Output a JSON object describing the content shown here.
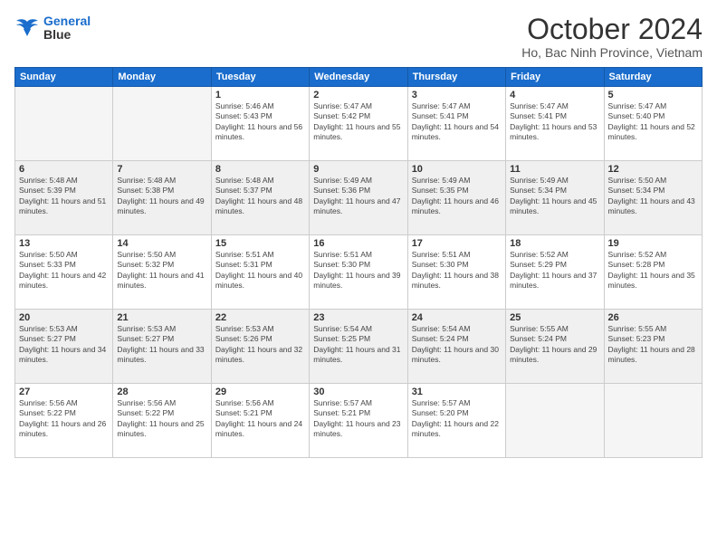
{
  "logo": {
    "line1": "General",
    "line2": "Blue"
  },
  "header": {
    "month": "October 2024",
    "location": "Ho, Bac Ninh Province, Vietnam"
  },
  "weekdays": [
    "Sunday",
    "Monday",
    "Tuesday",
    "Wednesday",
    "Thursday",
    "Friday",
    "Saturday"
  ],
  "weeks": [
    [
      {
        "day": null
      },
      {
        "day": null
      },
      {
        "day": "1",
        "sunrise": "Sunrise: 5:46 AM",
        "sunset": "Sunset: 5:43 PM",
        "daylight": "Daylight: 11 hours and 56 minutes."
      },
      {
        "day": "2",
        "sunrise": "Sunrise: 5:47 AM",
        "sunset": "Sunset: 5:42 PM",
        "daylight": "Daylight: 11 hours and 55 minutes."
      },
      {
        "day": "3",
        "sunrise": "Sunrise: 5:47 AM",
        "sunset": "Sunset: 5:41 PM",
        "daylight": "Daylight: 11 hours and 54 minutes."
      },
      {
        "day": "4",
        "sunrise": "Sunrise: 5:47 AM",
        "sunset": "Sunset: 5:41 PM",
        "daylight": "Daylight: 11 hours and 53 minutes."
      },
      {
        "day": "5",
        "sunrise": "Sunrise: 5:47 AM",
        "sunset": "Sunset: 5:40 PM",
        "daylight": "Daylight: 11 hours and 52 minutes."
      }
    ],
    [
      {
        "day": "6",
        "sunrise": "Sunrise: 5:48 AM",
        "sunset": "Sunset: 5:39 PM",
        "daylight": "Daylight: 11 hours and 51 minutes."
      },
      {
        "day": "7",
        "sunrise": "Sunrise: 5:48 AM",
        "sunset": "Sunset: 5:38 PM",
        "daylight": "Daylight: 11 hours and 49 minutes."
      },
      {
        "day": "8",
        "sunrise": "Sunrise: 5:48 AM",
        "sunset": "Sunset: 5:37 PM",
        "daylight": "Daylight: 11 hours and 48 minutes."
      },
      {
        "day": "9",
        "sunrise": "Sunrise: 5:49 AM",
        "sunset": "Sunset: 5:36 PM",
        "daylight": "Daylight: 11 hours and 47 minutes."
      },
      {
        "day": "10",
        "sunrise": "Sunrise: 5:49 AM",
        "sunset": "Sunset: 5:35 PM",
        "daylight": "Daylight: 11 hours and 46 minutes."
      },
      {
        "day": "11",
        "sunrise": "Sunrise: 5:49 AM",
        "sunset": "Sunset: 5:34 PM",
        "daylight": "Daylight: 11 hours and 45 minutes."
      },
      {
        "day": "12",
        "sunrise": "Sunrise: 5:50 AM",
        "sunset": "Sunset: 5:34 PM",
        "daylight": "Daylight: 11 hours and 43 minutes."
      }
    ],
    [
      {
        "day": "13",
        "sunrise": "Sunrise: 5:50 AM",
        "sunset": "Sunset: 5:33 PM",
        "daylight": "Daylight: 11 hours and 42 minutes."
      },
      {
        "day": "14",
        "sunrise": "Sunrise: 5:50 AM",
        "sunset": "Sunset: 5:32 PM",
        "daylight": "Daylight: 11 hours and 41 minutes."
      },
      {
        "day": "15",
        "sunrise": "Sunrise: 5:51 AM",
        "sunset": "Sunset: 5:31 PM",
        "daylight": "Daylight: 11 hours and 40 minutes."
      },
      {
        "day": "16",
        "sunrise": "Sunrise: 5:51 AM",
        "sunset": "Sunset: 5:30 PM",
        "daylight": "Daylight: 11 hours and 39 minutes."
      },
      {
        "day": "17",
        "sunrise": "Sunrise: 5:51 AM",
        "sunset": "Sunset: 5:30 PM",
        "daylight": "Daylight: 11 hours and 38 minutes."
      },
      {
        "day": "18",
        "sunrise": "Sunrise: 5:52 AM",
        "sunset": "Sunset: 5:29 PM",
        "daylight": "Daylight: 11 hours and 37 minutes."
      },
      {
        "day": "19",
        "sunrise": "Sunrise: 5:52 AM",
        "sunset": "Sunset: 5:28 PM",
        "daylight": "Daylight: 11 hours and 35 minutes."
      }
    ],
    [
      {
        "day": "20",
        "sunrise": "Sunrise: 5:53 AM",
        "sunset": "Sunset: 5:27 PM",
        "daylight": "Daylight: 11 hours and 34 minutes."
      },
      {
        "day": "21",
        "sunrise": "Sunrise: 5:53 AM",
        "sunset": "Sunset: 5:27 PM",
        "daylight": "Daylight: 11 hours and 33 minutes."
      },
      {
        "day": "22",
        "sunrise": "Sunrise: 5:53 AM",
        "sunset": "Sunset: 5:26 PM",
        "daylight": "Daylight: 11 hours and 32 minutes."
      },
      {
        "day": "23",
        "sunrise": "Sunrise: 5:54 AM",
        "sunset": "Sunset: 5:25 PM",
        "daylight": "Daylight: 11 hours and 31 minutes."
      },
      {
        "day": "24",
        "sunrise": "Sunrise: 5:54 AM",
        "sunset": "Sunset: 5:24 PM",
        "daylight": "Daylight: 11 hours and 30 minutes."
      },
      {
        "day": "25",
        "sunrise": "Sunrise: 5:55 AM",
        "sunset": "Sunset: 5:24 PM",
        "daylight": "Daylight: 11 hours and 29 minutes."
      },
      {
        "day": "26",
        "sunrise": "Sunrise: 5:55 AM",
        "sunset": "Sunset: 5:23 PM",
        "daylight": "Daylight: 11 hours and 28 minutes."
      }
    ],
    [
      {
        "day": "27",
        "sunrise": "Sunrise: 5:56 AM",
        "sunset": "Sunset: 5:22 PM",
        "daylight": "Daylight: 11 hours and 26 minutes."
      },
      {
        "day": "28",
        "sunrise": "Sunrise: 5:56 AM",
        "sunset": "Sunset: 5:22 PM",
        "daylight": "Daylight: 11 hours and 25 minutes."
      },
      {
        "day": "29",
        "sunrise": "Sunrise: 5:56 AM",
        "sunset": "Sunset: 5:21 PM",
        "daylight": "Daylight: 11 hours and 24 minutes."
      },
      {
        "day": "30",
        "sunrise": "Sunrise: 5:57 AM",
        "sunset": "Sunset: 5:21 PM",
        "daylight": "Daylight: 11 hours and 23 minutes."
      },
      {
        "day": "31",
        "sunrise": "Sunrise: 5:57 AM",
        "sunset": "Sunset: 5:20 PM",
        "daylight": "Daylight: 11 hours and 22 minutes."
      },
      {
        "day": null
      },
      {
        "day": null
      }
    ]
  ],
  "colors": {
    "header_bg": "#1a6dcc",
    "shaded_row": "#f0f0f0",
    "empty_cell": "#f5f5f5"
  }
}
